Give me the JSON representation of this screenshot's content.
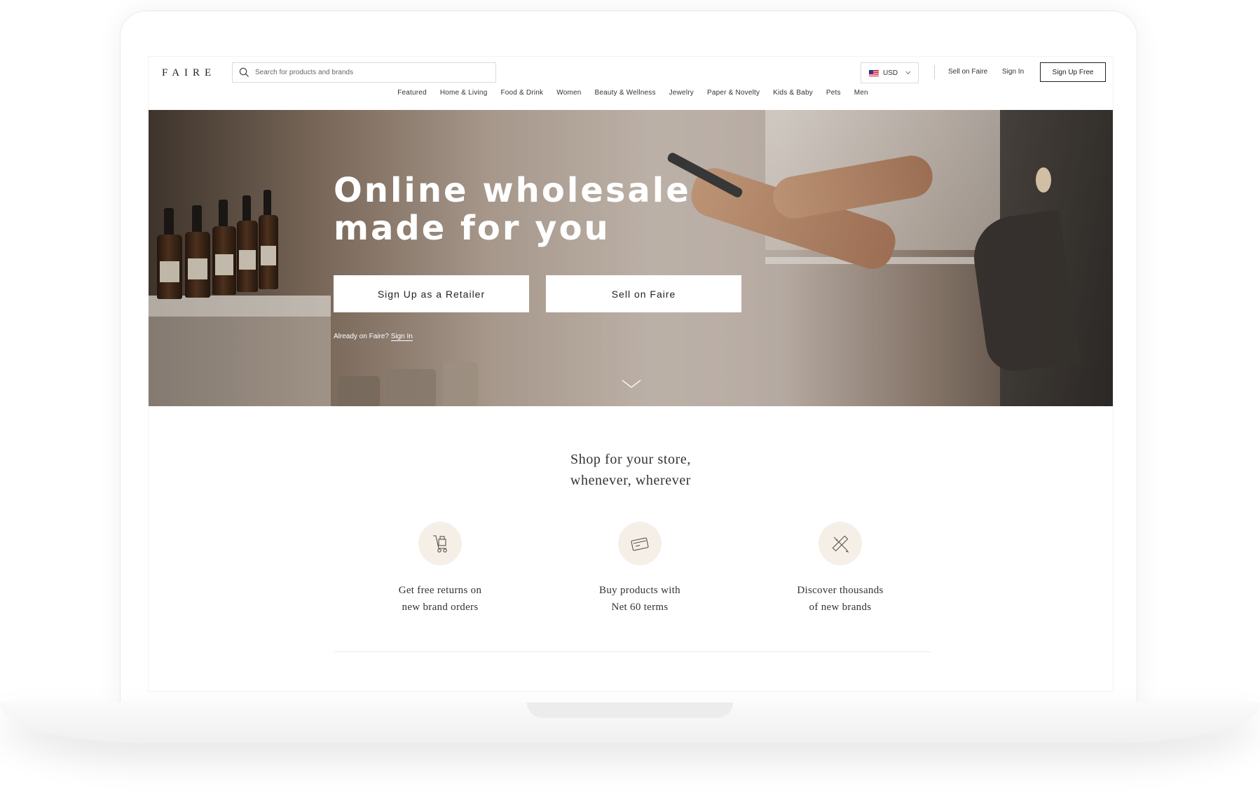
{
  "header": {
    "logo": "FAIRE",
    "search_placeholder": "Search for products and brands",
    "currency": "USD",
    "sell_link": "Sell on Faire",
    "signin_link": "Sign In",
    "signup_button": "Sign Up Free"
  },
  "nav": {
    "items": [
      "Featured",
      "Home & Living",
      "Food & Drink",
      "Women",
      "Beauty & Wellness",
      "Jewelry",
      "Paper & Novelty",
      "Kids & Baby",
      "Pets",
      "Men"
    ]
  },
  "hero": {
    "title_line1": "Online wholesale",
    "title_line2": "made for you",
    "retailer_button": "Sign Up as a Retailer",
    "brand_button": "Sell on Faire",
    "already_text": "Already on Faire?",
    "signin_link": "Sign In"
  },
  "section": {
    "title_line1": "Shop for your store,",
    "title_line2": "whenever, wherever"
  },
  "features": [
    {
      "icon": "hand-truck-icon",
      "line1": "Get free returns on",
      "line2": "new brand orders"
    },
    {
      "icon": "credit-card-icon",
      "line1": "Buy products with",
      "line2": "Net 60 terms"
    },
    {
      "icon": "pen-ruler-icon",
      "line1": "Discover thousands",
      "line2": "of new brands"
    }
  ],
  "colors": {
    "accent_circle": "#f6efe7",
    "text": "#333333",
    "button_border": "#222222"
  }
}
